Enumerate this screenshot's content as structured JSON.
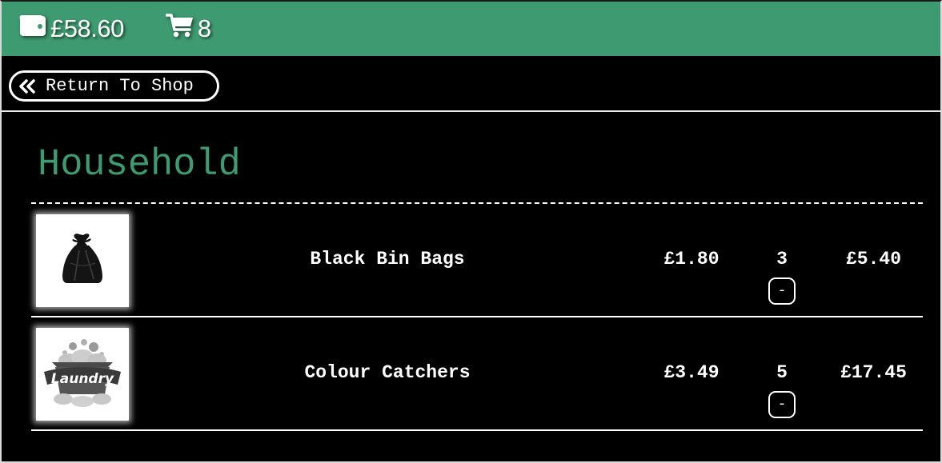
{
  "header": {
    "wallet_icon": "wallet-icon",
    "balance": "£58.60",
    "cart_icon": "cart-icon",
    "cart_count": "8",
    "bar_color": "#3e9a70"
  },
  "nav": {
    "return_icon": "double-chevron-left-icon",
    "return_label": "Return To Shop"
  },
  "category": {
    "title": "Household",
    "title_color": "#3e9a70"
  },
  "items": [
    {
      "image_icon": "bin-bag-icon",
      "name": "Black Bin Bags",
      "price": "£1.80",
      "quantity": "3",
      "total": "£5.40",
      "decrement_label": "-"
    },
    {
      "image_icon": "laundry-basket-icon",
      "image_text": "Laundry",
      "name": "Colour Catchers",
      "price": "£3.49",
      "quantity": "5",
      "total": "£17.45",
      "decrement_label": "-"
    }
  ]
}
